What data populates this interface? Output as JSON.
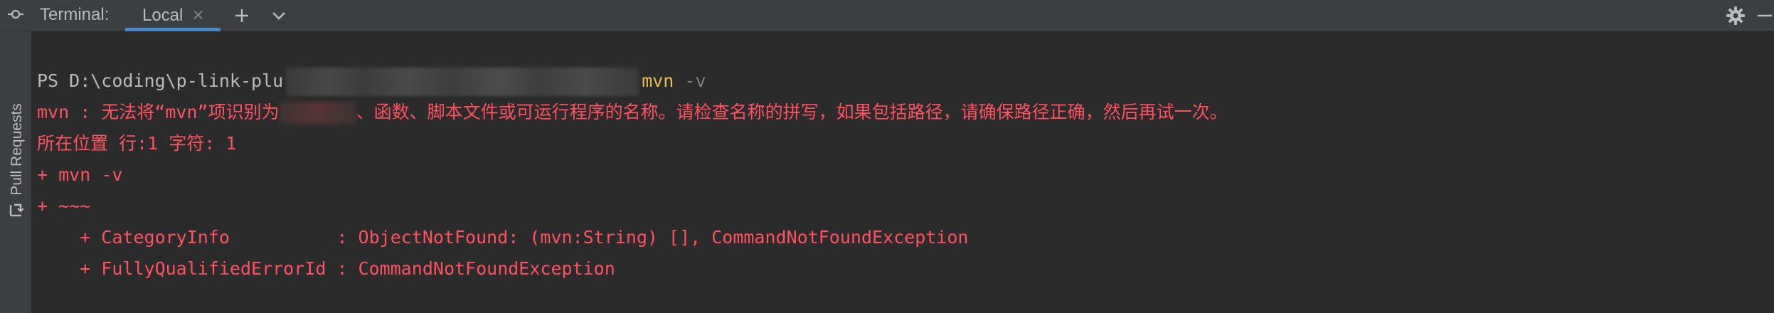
{
  "app": {
    "title": "Terminal:"
  },
  "tabs": [
    {
      "label": "Local",
      "active": true
    }
  ],
  "toolbar": {
    "add_icon": "plus-icon",
    "dropdown_icon": "chevron-down-icon",
    "settings_icon": "gear-icon",
    "minimize_icon": "minus-icon"
  },
  "sidebar": {
    "pull_requests_label": "Pull Requests"
  },
  "terminal": {
    "prompt_prefix": "PS D:\\coding\\p-link-plu",
    "command": "mvn",
    "command_args": "-v",
    "error_line_1_start": "mvn : 无法将“mvn”项识别为",
    "error_line_1_end": "、函数、脚本文件或可运行程序的名称。请检查名称的拼写，如果包括路径，请确保路径正确，然后再试一次。",
    "error_line_2": "所在位置 行:1 字符: 1",
    "error_line_3": "+ mvn -v",
    "error_line_4": "+ ~~~",
    "error_line_5": "    + CategoryInfo          : ObjectNotFound: (mvn:String) [], CommandNotFoundException",
    "error_line_6": "    + FullyQualifiedErrorId : CommandNotFoundException"
  },
  "colors": {
    "background": "#2b2b2b",
    "panel": "#3c3f41",
    "text": "#bbbbbb",
    "error": "#ff5261",
    "command": "#e8bf4d",
    "accent": "#4a88c7"
  }
}
